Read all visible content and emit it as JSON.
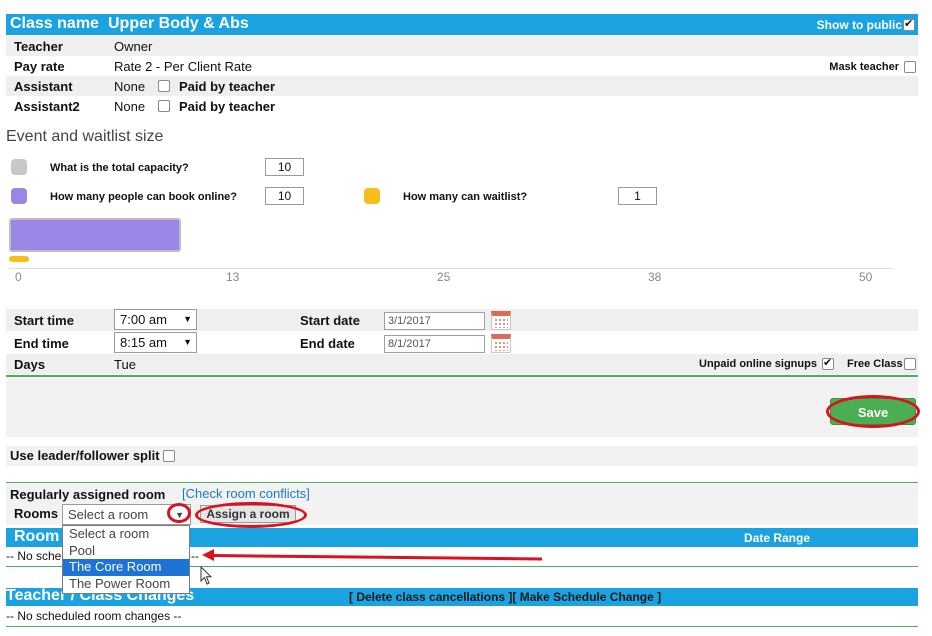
{
  "header": {
    "title_label": "Class name",
    "class_name": "Upper Body & Abs",
    "show_public_label": "Show to public"
  },
  "info": {
    "teacher_label": "Teacher",
    "teacher_value": "Owner",
    "payrate_label": "Pay rate",
    "payrate_value": "Rate 2 - Per Client Rate",
    "mask_teacher_label": "Mask teacher",
    "assistant_label": "Assistant",
    "assistant_value": "None",
    "assistant_paid_label": "Paid by teacher",
    "assistant2_label": "Assistant2",
    "assistant2_value": "None",
    "assistant2_paid_label": "Paid by teacher"
  },
  "capacity": {
    "section_title": "Event and waitlist size",
    "total_label": "What is the total capacity?",
    "total_value": "10",
    "online_label": "How many people can book online?",
    "online_value": "10",
    "waitlist_label": "How many can waitlist?",
    "waitlist_value": "1",
    "scale_ticks": [
      "0",
      "13",
      "25",
      "38",
      "50"
    ],
    "colors": {
      "total": "#c8c8c8",
      "online": "#9b86e6",
      "waitlist": "#f7bd1e"
    }
  },
  "schedule": {
    "start_time_label": "Start time",
    "start_time_value": "7:00 am",
    "end_time_label": "End time",
    "end_time_value": "8:15 am",
    "start_date_label": "Start date",
    "start_date_value": "3/1/2017",
    "end_date_label": "End date",
    "end_date_value": "8/1/2017",
    "days_label": "Days",
    "days_value": "Tue",
    "unpaid_label": "Unpaid online signups",
    "free_class_label": "Free Class"
  },
  "actions": {
    "save_label": "Save"
  },
  "leader": {
    "label": "Use leader/follower split"
  },
  "rooms": {
    "regular_label": "Regularly assigned room",
    "check_conflicts_link": "[Check room conflicts]",
    "rooms_label": "Rooms",
    "select_value": "Select a room",
    "assign_button": "Assign a room",
    "options": [
      "Select a room",
      "Pool",
      "The Core Room",
      "The Power Room"
    ],
    "room_bar_title": "Room",
    "date_range_label": "Date Range",
    "no_scheduled_prefix": "-- No sche",
    "no_scheduled_suffix": "--"
  },
  "changes": {
    "bar_title": "Teacher / Class Changes",
    "bar_links": "[ Delete class cancellations ][ Make Schedule Change ]",
    "none_text": "-- No scheduled room changes --"
  }
}
